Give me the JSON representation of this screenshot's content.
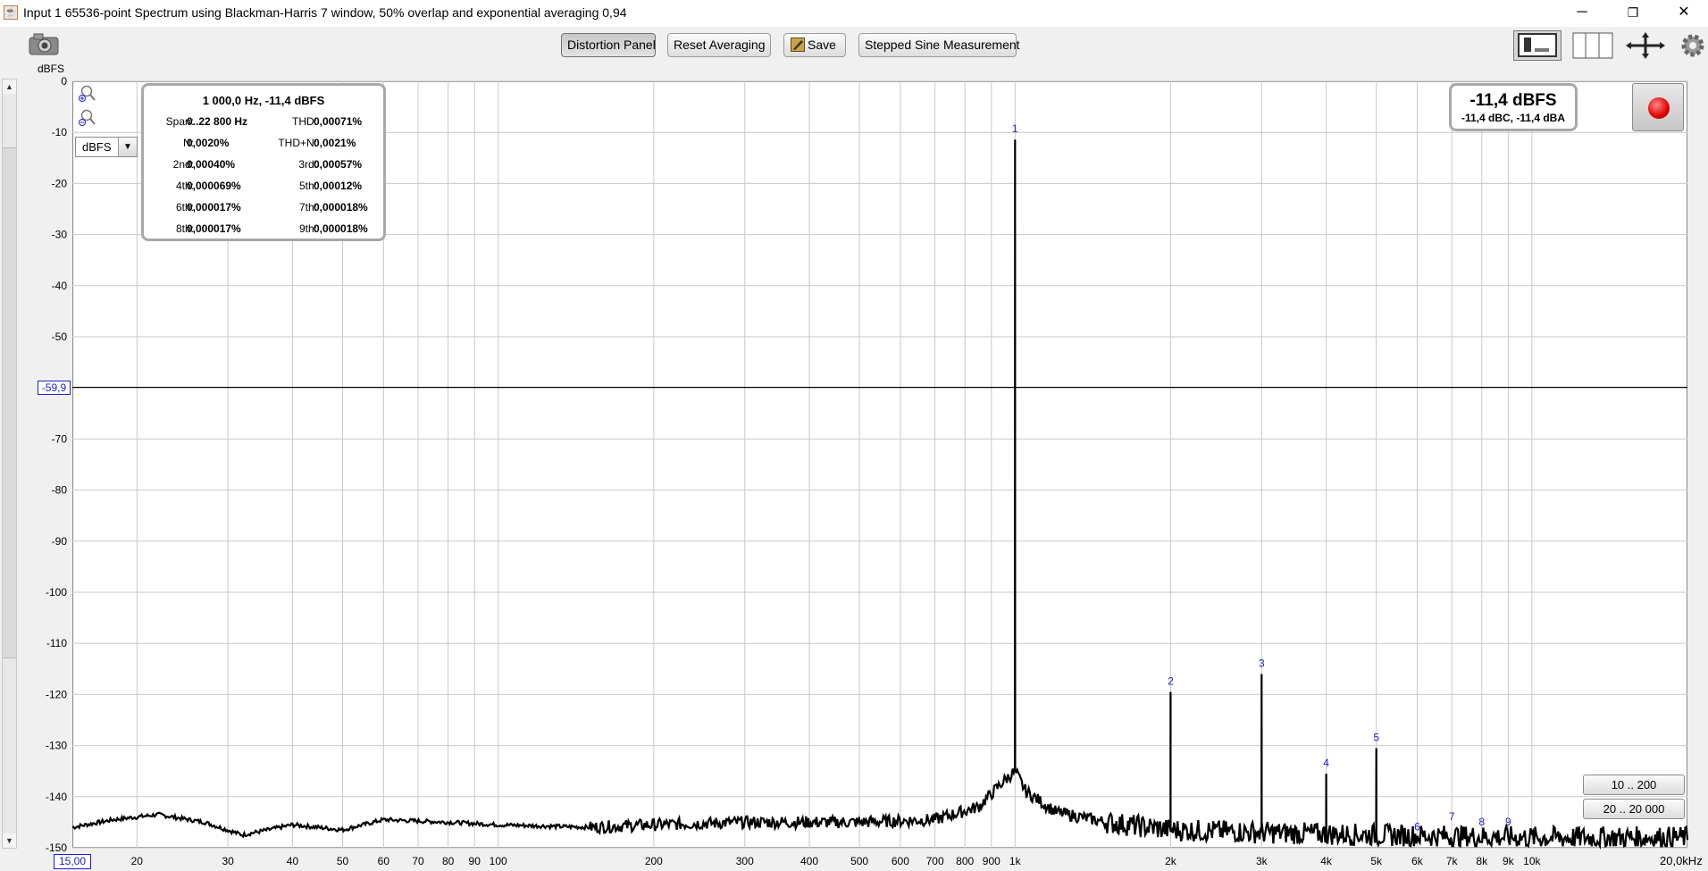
{
  "window": {
    "title": "Input 1 65536-point Spectrum using Blackman-Harris 7 window, 50% overlap and exponential averaging 0,94",
    "minimize": "─",
    "restore": "❐",
    "close": "✕"
  },
  "toolbar": {
    "distortion_panel": "Distortion Panel",
    "reset_averaging": "Reset Averaging",
    "save": "Save",
    "stepped_sine": "Stepped Sine Measurement"
  },
  "axis_unit_label": "dBFS",
  "unit_select": {
    "value": "dBFS"
  },
  "cursor": {
    "y_readout": "-59,9",
    "x_readout": "15,00"
  },
  "x_end_label": "20,0kHz",
  "info_panel": {
    "header": "1 000,0 Hz, -11,4 dBFS",
    "rows": [
      {
        "l": "Span:",
        "lv": "0..22 800 Hz",
        "r": "THD:",
        "rv": "0,00071%"
      },
      {
        "l": "N:",
        "lv": "0,0020%",
        "r": "THD+N:",
        "rv": "0,0021%"
      },
      {
        "l": "2nd:",
        "lv": "0,00040%",
        "r": "3rd:",
        "rv": "0,00057%"
      },
      {
        "l": "4th:",
        "lv": "0,000069%",
        "r": "5th:",
        "rv": "0,00012%"
      },
      {
        "l": "6th:",
        "lv": "0,000017%",
        "r": "7th:",
        "rv": "0,000018%"
      },
      {
        "l": "8th:",
        "lv": "0,000017%",
        "r": "9th:",
        "rv": "0,000018%"
      }
    ]
  },
  "level_display": {
    "main": "-11,4 dBFS",
    "sub": "-11,4 dBC, -11,4 dBA"
  },
  "range_buttons": {
    "r1": "10 .. 200",
    "r2": "20 .. 20 000"
  },
  "colors": {
    "marker": "#1f1fd0",
    "trace": "#000000",
    "grid": "#c8c8c8"
  },
  "chart_data": {
    "type": "line",
    "xscale": "log",
    "xlim": [
      15,
      20000
    ],
    "ylim": [
      -150,
      0
    ],
    "y_ticks": [
      0,
      -10,
      -20,
      -30,
      -40,
      -50,
      -70,
      -80,
      -90,
      -100,
      -110,
      -120,
      -130,
      -140,
      -150
    ],
    "x_ticks": [
      {
        "v": 20,
        "t": "20"
      },
      {
        "v": 30,
        "t": "30"
      },
      {
        "v": 40,
        "t": "40"
      },
      {
        "v": 50,
        "t": "50"
      },
      {
        "v": 60,
        "t": "60"
      },
      {
        "v": 70,
        "t": "70"
      },
      {
        "v": 80,
        "t": "80"
      },
      {
        "v": 90,
        "t": "90"
      },
      {
        "v": 100,
        "t": "100"
      },
      {
        "v": 200,
        "t": "200"
      },
      {
        "v": 300,
        "t": "300"
      },
      {
        "v": 400,
        "t": "400"
      },
      {
        "v": 500,
        "t": "500"
      },
      {
        "v": 600,
        "t": "600"
      },
      {
        "v": 700,
        "t": "700"
      },
      {
        "v": 800,
        "t": "800"
      },
      {
        "v": 900,
        "t": "900"
      },
      {
        "v": 1000,
        "t": "1k"
      },
      {
        "v": 2000,
        "t": "2k"
      },
      {
        "v": 3000,
        "t": "3k"
      },
      {
        "v": 4000,
        "t": "4k"
      },
      {
        "v": 5000,
        "t": "5k"
      },
      {
        "v": 6000,
        "t": "6k"
      },
      {
        "v": 7000,
        "t": "7k"
      },
      {
        "v": 8000,
        "t": "8k"
      },
      {
        "v": 9000,
        "t": "9k"
      },
      {
        "v": 10000,
        "t": "10k"
      }
    ],
    "cursor_level": -59.9,
    "noise_floor": [
      [
        15,
        -146
      ],
      [
        18,
        -144.5
      ],
      [
        22,
        -143.5
      ],
      [
        27,
        -145
      ],
      [
        32,
        -147.5
      ],
      [
        40,
        -145.5
      ],
      [
        50,
        -146.5
      ],
      [
        60,
        -144.5
      ],
      [
        80,
        -145
      ],
      [
        100,
        -145.5
      ],
      [
        150,
        -146
      ],
      [
        200,
        -145.5
      ],
      [
        300,
        -145
      ],
      [
        500,
        -145
      ],
      [
        700,
        -144.5
      ],
      [
        850,
        -142
      ],
      [
        950,
        -137
      ],
      [
        1000,
        -135
      ],
      [
        1050,
        -139
      ],
      [
        1200,
        -143
      ],
      [
        1500,
        -145
      ],
      [
        2000,
        -146.5
      ],
      [
        3000,
        -147
      ],
      [
        5000,
        -147.5
      ],
      [
        10000,
        -148
      ],
      [
        20000,
        -148
      ]
    ],
    "peaks": [
      {
        "n": "1",
        "f": 1000,
        "db": -11.4
      },
      {
        "n": "2",
        "f": 2000,
        "db": -119.5
      },
      {
        "n": "3",
        "f": 3000,
        "db": -116
      },
      {
        "n": "4",
        "f": 4000,
        "db": -135.5
      },
      {
        "n": "5",
        "f": 5000,
        "db": -130.5
      },
      {
        "n": "6",
        "f": 6000,
        "db": -148
      },
      {
        "n": "7",
        "f": 7000,
        "db": -146
      },
      {
        "n": "8",
        "f": 8000,
        "db": -147
      },
      {
        "n": "9",
        "f": 9000,
        "db": -147
      }
    ]
  }
}
